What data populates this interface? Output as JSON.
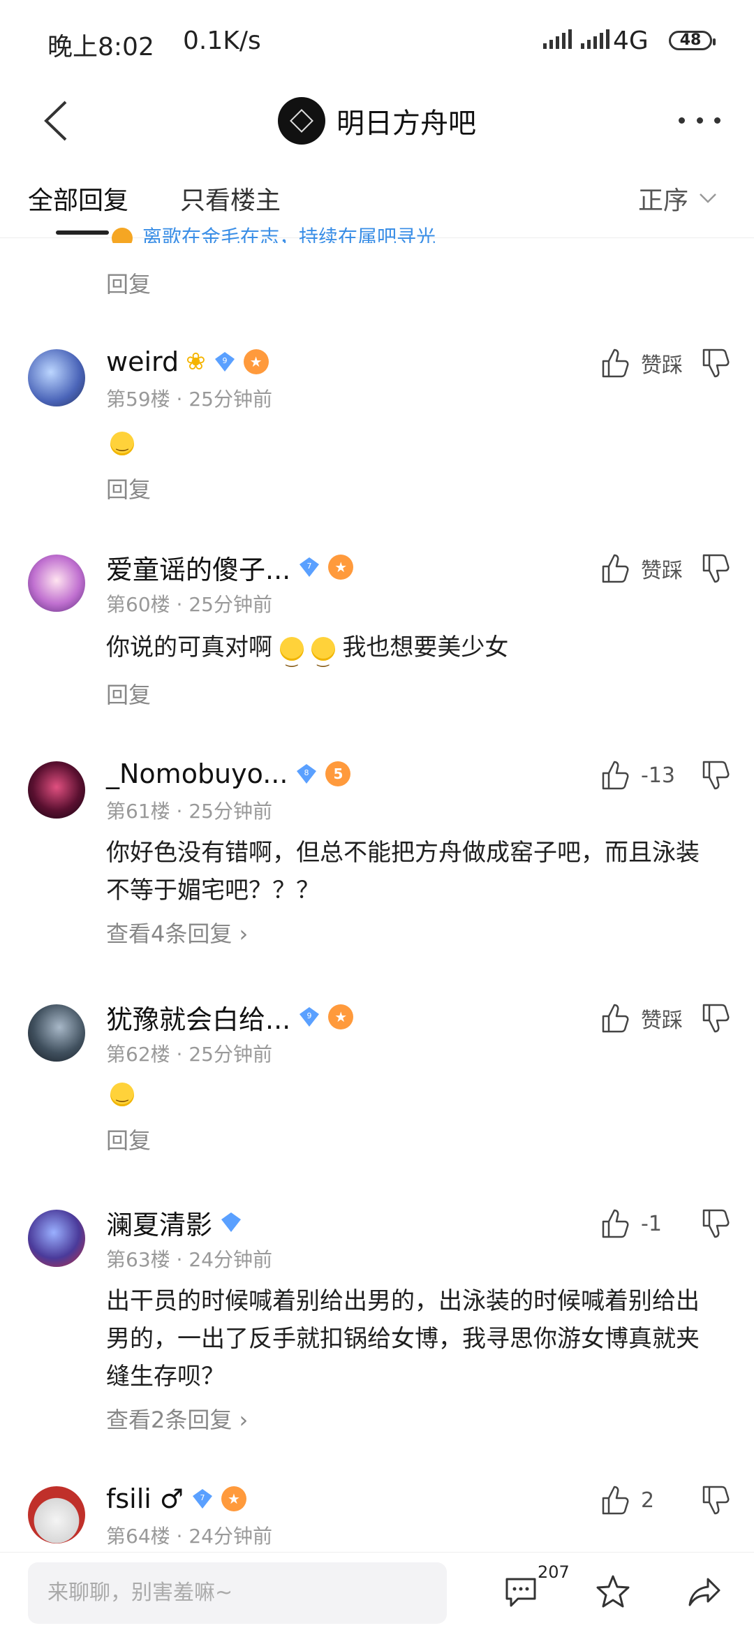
{
  "status_bar": {
    "time": "晚上8:02",
    "speed": "0.1K/s",
    "network": "4G",
    "battery": "48"
  },
  "header": {
    "forum_name": "明日方舟吧"
  },
  "tabs": {
    "all": "全部回复",
    "owner": "只看楼主",
    "sort": "正序"
  },
  "partial": {
    "sub_text": "离歌在金毛在志，持续在属吧寻光",
    "reply": "回复"
  },
  "comments": [
    {
      "name": "weird",
      "level": "9",
      "rank": "",
      "floor": "第59楼",
      "time": "25分钟前",
      "text": "",
      "vote": "赞踩",
      "footer": "回复"
    },
    {
      "name": "爱童谣的傻子...",
      "level": "7",
      "rank": "",
      "floor": "第60楼",
      "time": "25分钟前",
      "text_before": "你说的可真对啊",
      "text_after": "我也想要美少女",
      "vote": "赞踩",
      "footer": "回复"
    },
    {
      "name": "_Nomobuyo...",
      "level": "8",
      "rank": "5",
      "floor": "第61楼",
      "time": "25分钟前",
      "text": "你好色没有错啊，但总不能把方舟做成窑子吧，而且泳装不等于媚宅吧？？？",
      "vote": "-13",
      "footer": "查看4条回复 ›"
    },
    {
      "name": "犹豫就会白给...",
      "level": "9",
      "rank": "",
      "floor": "第62楼",
      "time": "25分钟前",
      "text": "",
      "vote": "赞踩",
      "footer": "回复"
    },
    {
      "name": "澜夏清影",
      "level": "",
      "rank": "",
      "floor": "第63楼",
      "time": "24分钟前",
      "text": "出干员的时候喊着别给出男的，出泳装的时候喊着别给出男的，一出了反手就扣锅给女博，我寻思你游女博真就夹缝生存呗？",
      "vote": "-1",
      "footer": "查看2条回复 ›"
    },
    {
      "name": "fsili ♂",
      "level": "7",
      "rank": "",
      "floor": "第64楼",
      "time": "24分钟前",
      "text": "",
      "vote": "2",
      "footer": ""
    }
  ],
  "bottom": {
    "placeholder": "来聊聊，别害羞嘛~",
    "comment_count": "207"
  },
  "colors": {
    "link_blue": "#3a8ee6",
    "meta_gray": "#999999",
    "diamond_blue": "#5aa0ff",
    "level_orange": "#ff9a3c"
  }
}
